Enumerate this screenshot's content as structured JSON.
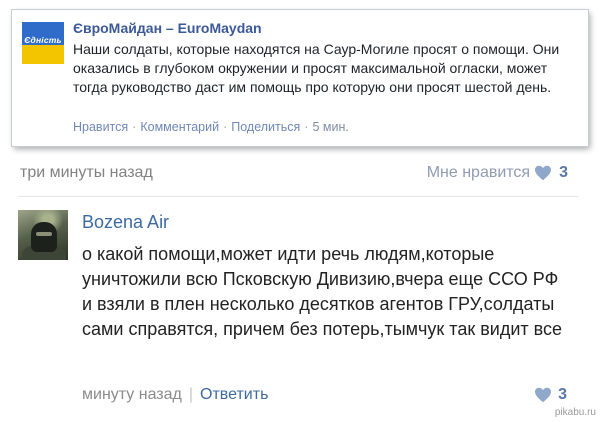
{
  "post": {
    "author": "ЄвроМайдан – EuroMaydan",
    "avatar_text": "Єдність",
    "text": "Наши солдаты, которые находятся на Саур-Могиле просят о помощи. Они оказались в глубоком окружении и просят максимальной огласки, может тогда руководство даст им помощь про которую они просят шестой день.",
    "actions": {
      "like": "Нравится",
      "comment": "Комментарий",
      "share": "Поделиться",
      "time": "5 мин."
    }
  },
  "meta": {
    "time": "три минуты назад",
    "like_label": "Мне нравится",
    "like_count": "3",
    "heart_color": "#8fa7c9"
  },
  "comment": {
    "author": "Bozena Air",
    "text": "о какой помощи,может идти речь людям,которые уничтожили всю Псковскую Дивизию,вчера еще ССО РФ и взяли в плен несколько десятков агентов ГРУ,солдаты сами справятся, причем без потерь,тымчук так видит все",
    "time": "минуту назад",
    "reply": "Ответить",
    "like_count": "3"
  },
  "watermark": "pikabu.ru"
}
